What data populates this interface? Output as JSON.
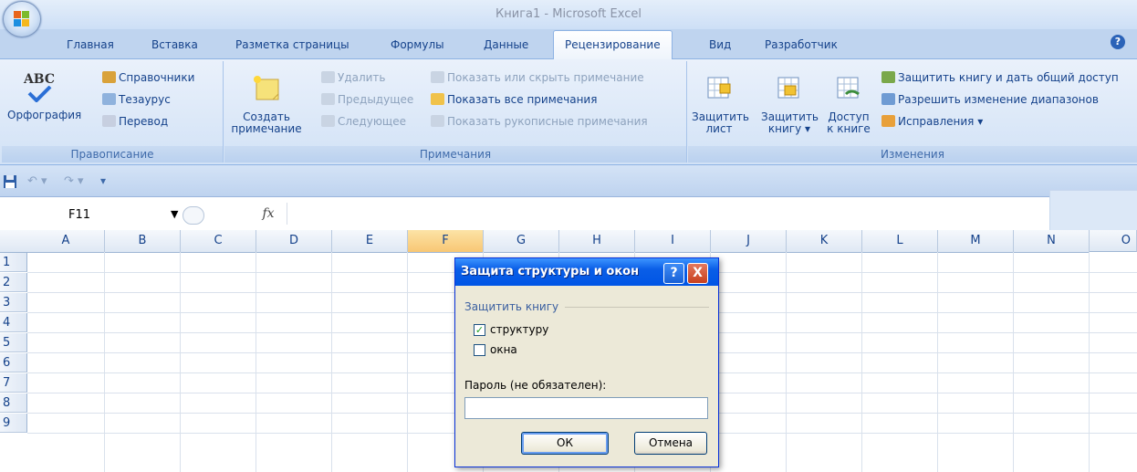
{
  "window": {
    "title": "Книга1 - Microsoft Excel"
  },
  "tabs": [
    "Главная",
    "Вставка",
    "Разметка страницы",
    "Формулы",
    "Данные",
    "Рецензирование",
    "Вид",
    "Разработчик"
  ],
  "active_tab": "Рецензирование",
  "ribbon": {
    "proofing": {
      "group_label": "Правописание",
      "spelling_icon_text": "ABC",
      "spelling": "Орфография",
      "research": "Справочники",
      "thesaurus": "Тезаурус",
      "translate": "Перевод"
    },
    "comments": {
      "group_label": "Примечания",
      "new_comment_line1": "Создать",
      "new_comment_line2": "примечание",
      "delete": "Удалить",
      "previous": "Предыдущее",
      "next": "Следующее",
      "show_hide": "Показать или скрыть примечание",
      "show_all": "Показать все примечания",
      "show_ink": "Показать рукописные примечания"
    },
    "changes": {
      "group_label": "Изменения",
      "protect_sheet_line1": "Защитить",
      "protect_sheet_line2": "лист",
      "protect_book_line1": "Защитить",
      "protect_book_line2": "книгу",
      "share_line1": "Доступ",
      "share_line2": "к книге",
      "protect_share": "Защитить книгу и дать общий доступ",
      "allow_ranges": "Разрешить изменение диапазонов",
      "track_changes": "Исправления"
    }
  },
  "formula_bar": {
    "name_box": "F11",
    "fx": "fx",
    "value": ""
  },
  "grid": {
    "columns": [
      "A",
      "B",
      "C",
      "D",
      "E",
      "F",
      "G",
      "H",
      "I",
      "J",
      "K",
      "L",
      "M",
      "N",
      "O"
    ],
    "rows": [
      "1",
      "2",
      "3",
      "4",
      "5",
      "6",
      "7",
      "8",
      "9"
    ],
    "selected_column": "F"
  },
  "dialog": {
    "title": "Защита структуры и окон",
    "help": "?",
    "close": "X",
    "section": "Защитить книгу",
    "structure": "структуру",
    "structure_checked": true,
    "windows": "окна",
    "windows_checked": false,
    "password_label": "Пароль (не обязателен):",
    "password_value": "",
    "ok": "ОК",
    "cancel": "Отмена"
  }
}
